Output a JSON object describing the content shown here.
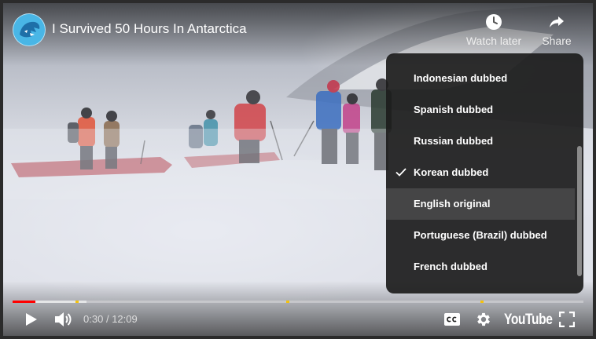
{
  "video": {
    "title": "I Survived 50 Hours In Antarctica",
    "time_current": "0:30",
    "time_separator": "/",
    "time_total": "12:09",
    "progress_played_fraction": 0.04,
    "progress_loaded_fraction": 0.13,
    "chapter_marker_fractions": [
      0.11,
      0.48,
      0.82
    ]
  },
  "top_actions": {
    "watch_later_label": "Watch later",
    "share_label": "Share"
  },
  "audio_track_menu": {
    "items": [
      {
        "label": "Indonesian dubbed",
        "checked": false,
        "highlighted": false
      },
      {
        "label": "Spanish dubbed",
        "checked": false,
        "highlighted": false
      },
      {
        "label": "Russian dubbed",
        "checked": false,
        "highlighted": false
      },
      {
        "label": "Korean dubbed",
        "checked": true,
        "highlighted": false
      },
      {
        "label": "English original",
        "checked": false,
        "highlighted": true
      },
      {
        "label": "Portuguese (Brazil) dubbed",
        "checked": false,
        "highlighted": false
      },
      {
        "label": "French dubbed",
        "checked": false,
        "highlighted": false
      }
    ]
  },
  "controls": {
    "logo_text": "YouTube",
    "icons": [
      "play-icon",
      "volume-icon",
      "captions-icon",
      "settings-gear-icon",
      "fullscreen-icon",
      "clock-icon",
      "share-arrow-icon"
    ]
  },
  "colors": {
    "progress_played": "#ff0000",
    "chapter_marker": "#f4c20d",
    "menu_background": "#1c1c1c"
  }
}
